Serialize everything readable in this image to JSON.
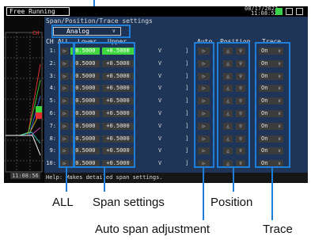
{
  "topbar": {
    "mode_label": "Free Running",
    "date": "08/17/2023",
    "time": "11:08:52",
    "icons": [
      "memory-icon",
      "sd-card-icon",
      "usb-icon"
    ]
  },
  "waveform": {
    "channel_label": "CH",
    "time_label": "11:08:56",
    "colors": [
      "#e03030",
      "#30c030",
      "#3060e0",
      "#d0a020",
      "#c040c0",
      "#30c0c0",
      "#ffffff"
    ]
  },
  "panel": {
    "title": "Span/Position/Trace settings",
    "range_select": "Analog",
    "headers": {
      "ch": "CH",
      "all": "ALL",
      "lower": "Lower",
      "upper": "Upper",
      "auto": "Auto",
      "position": "Position",
      "trace": "Trace"
    },
    "all_button_icon": "play-icon",
    "rows": [
      {
        "ch": "1:",
        "lower": "-0.5000",
        "upper": "+0.5000",
        "unit": "V",
        "bracket": "]",
        "trace": "On",
        "selected": true
      },
      {
        "ch": "2:",
        "lower": "-0.5000",
        "upper": "+0.5000",
        "unit": "V",
        "bracket": "]",
        "trace": "On",
        "selected": false
      },
      {
        "ch": "3:",
        "lower": "-0.5000",
        "upper": "+0.5000",
        "unit": "V",
        "bracket": "]",
        "trace": "On",
        "selected": false
      },
      {
        "ch": "4:",
        "lower": "-0.5000",
        "upper": "+0.5000",
        "unit": "V",
        "bracket": "]",
        "trace": "On",
        "selected": false
      },
      {
        "ch": "5:",
        "lower": "-0.5000",
        "upper": "+0.5000",
        "unit": "V",
        "bracket": "]",
        "trace": "On",
        "selected": false
      },
      {
        "ch": "6:",
        "lower": "-0.5000",
        "upper": "+0.5000",
        "unit": "V",
        "bracket": "]",
        "trace": "On",
        "selected": false
      },
      {
        "ch": "7:",
        "lower": "-0.5000",
        "upper": "+0.5000",
        "unit": "V",
        "bracket": "]",
        "trace": "On",
        "selected": false
      },
      {
        "ch": "8:",
        "lower": "-0.5000",
        "upper": "+0.5000",
        "unit": "V",
        "bracket": "]",
        "trace": "On",
        "selected": false
      },
      {
        "ch": "9:",
        "lower": "-0.5000",
        "upper": "+0.5000",
        "unit": "V",
        "bracket": "]",
        "trace": "On",
        "selected": false
      },
      {
        "ch": "10:",
        "lower": "-0.5000",
        "upper": "+0.5000",
        "unit": "V",
        "bracket": "]",
        "trace": "On",
        "selected": false
      }
    ],
    "help_text": "Help: Makes detailed span settings."
  },
  "callouts": {
    "all": "ALL",
    "span": "Span settings",
    "position": "Position",
    "auto": "Auto span adjustment",
    "trace": "Trace"
  },
  "accent_color": "#1f7fd8",
  "selection_color": "#3fd73f"
}
